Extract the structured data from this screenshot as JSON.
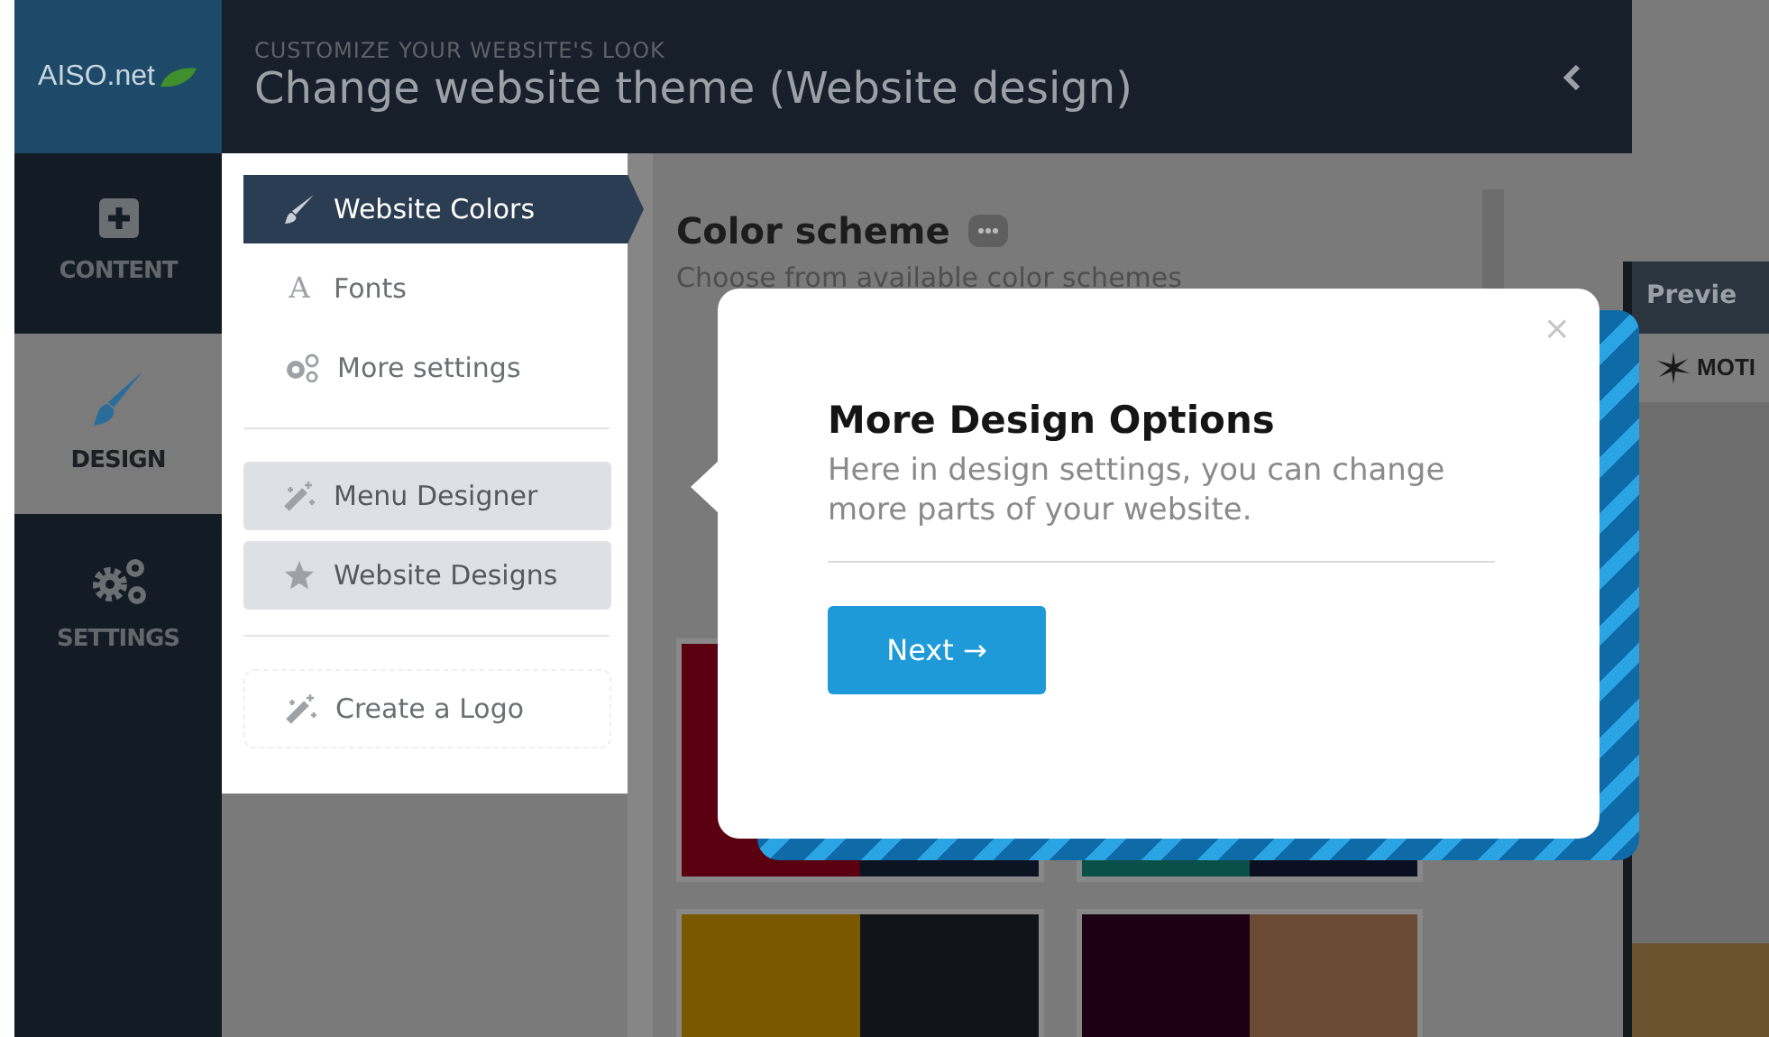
{
  "logo": {
    "text": "AISO.net"
  },
  "sidebar": {
    "items": [
      {
        "label": "CONTENT",
        "selected": false
      },
      {
        "label": "DESIGN",
        "selected": true
      },
      {
        "label": "SETTINGS",
        "selected": false
      }
    ]
  },
  "header": {
    "subtitle": "CUSTOMIZE YOUR WEBSITE'S LOOK",
    "title": "Change website theme (Website design)"
  },
  "menu": {
    "groups": [
      {
        "items": [
          {
            "label": "Website Colors",
            "kind": "link",
            "selected": true
          },
          {
            "label": "Fonts",
            "glyph": "A",
            "kind": "link",
            "selected": false
          },
          {
            "label": "More settings",
            "kind": "link",
            "selected": false
          }
        ]
      },
      {
        "items": [
          {
            "label": "Menu Designer",
            "kind": "button",
            "selected": false
          },
          {
            "label": "Website Designs",
            "kind": "button",
            "selected": false
          }
        ]
      },
      {
        "items": [
          {
            "label": "Create a Logo",
            "kind": "outline",
            "selected": false
          }
        ]
      }
    ]
  },
  "content": {
    "heading": "Color scheme",
    "subtitle": "Choose from available color schemes",
    "palettes": [
      {
        "swatches": [
          {
            "color": "#5a0010"
          },
          {
            "color": "#0b1420"
          }
        ]
      },
      {
        "swatches": [
          {
            "color": "#0a5048"
          },
          {
            "color": "#0b1020"
          }
        ]
      },
      {
        "swatches": [
          {
            "color": "#7a5800"
          },
          {
            "color": "#111418"
          }
        ]
      },
      {
        "swatches": [
          {
            "color": "#1e0014"
          },
          {
            "color": "#6b4a33"
          }
        ]
      }
    ]
  },
  "preview": {
    "title": "Previe",
    "site_logo": "MOTI"
  },
  "popover": {
    "close": "×",
    "title": "More Design Options",
    "body": "Here in design settings, you can change more parts of your website.",
    "button": "Next →"
  }
}
